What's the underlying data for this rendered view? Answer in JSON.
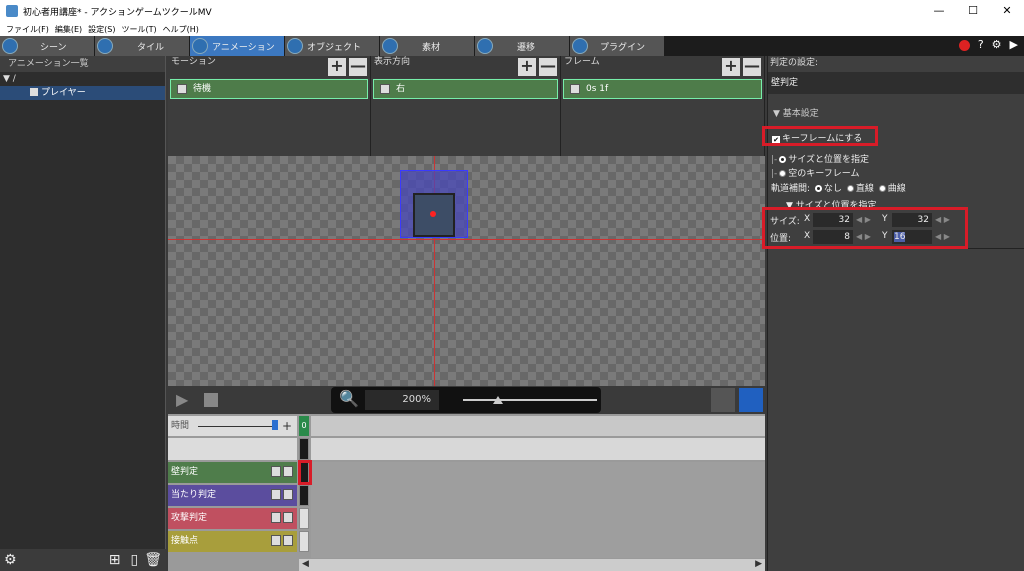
{
  "window": {
    "title": "初心者用講座* - アクションゲームツクールMV",
    "minimize": "—",
    "maximize": "☐",
    "close": "✕"
  },
  "menu": [
    "ファイル(F)",
    "編集(E)",
    "設定(S)",
    "ツール(T)",
    "ヘルプ(H)"
  ],
  "tabs": [
    {
      "label": "シーン",
      "icon": "scene-icon"
    },
    {
      "label": "タイル",
      "icon": "tile-icon"
    },
    {
      "label": "アニメーション",
      "icon": "animation-icon"
    },
    {
      "label": "オブジェクト",
      "icon": "object-icon"
    },
    {
      "label": "素材",
      "icon": "material-icon"
    },
    {
      "label": "遷移",
      "icon": "transition-icon"
    },
    {
      "label": "プラグイン",
      "icon": "plugin-icon"
    }
  ],
  "tab_right": {
    "help": "?",
    "settings": "⚙",
    "play": "▶"
  },
  "left": {
    "header": "アニメーション一覧",
    "root": "▼ /",
    "item": "プレイヤー"
  },
  "columns": {
    "motion": {
      "header": "モーション",
      "item": "待機"
    },
    "direction": {
      "header": "表示方向",
      "item": "右"
    },
    "frame": {
      "header": "フレーム",
      "item": "0s 1f"
    },
    "plus": "+",
    "minus": "—"
  },
  "controls": {
    "zoom": "200%"
  },
  "timeline": {
    "time_label": "時間",
    "frame0": "0",
    "tracks": [
      {
        "label": "壁判定",
        "color": "#4f7d4b"
      },
      {
        "label": "当たり判定",
        "color": "#5b4d9e"
      },
      {
        "label": "攻撃判定",
        "color": "#c05060"
      },
      {
        "label": "接触点",
        "color": "#a89e3c"
      }
    ]
  },
  "right": {
    "header": "判定の設定:",
    "name": "壁判定",
    "basic_section": "▼ 基本設定",
    "keyframe_label": "キーフレームにする",
    "opt_size_pos": "サイズと位置を指定",
    "opt_empty_key": "空のキーフレーム",
    "interp_label": "軌道補間:",
    "interp_none": "なし",
    "interp_linear": "直線",
    "interp_curve": "曲線",
    "size_section": "▼ サイズと位置を指定",
    "size_label": "サイズ:",
    "pos_label": "位置:",
    "x": "X",
    "y": "Y",
    "size_x": "32",
    "size_y": "32",
    "pos_x": "8",
    "pos_y": "16"
  },
  "highlight_color": "#d81c28",
  "accent_color": "#3c78c0"
}
